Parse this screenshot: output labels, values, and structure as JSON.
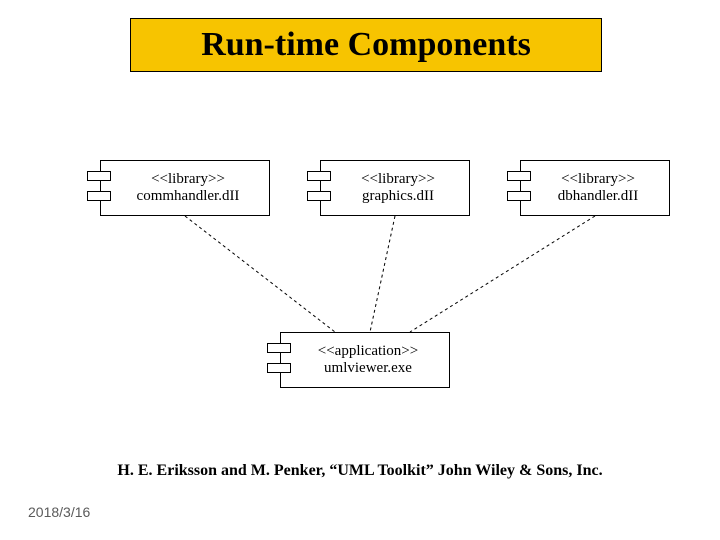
{
  "title": "Run-time Components",
  "components": [
    {
      "stereotype": "<<library>>",
      "name": "commhandler.dII"
    },
    {
      "stereotype": "<<library>>",
      "name": "graphics.dII"
    },
    {
      "stereotype": "<<library>>",
      "name": "dbhandler.dII"
    },
    {
      "stereotype": "<<application>>",
      "name": "umlviewer.exe"
    }
  ],
  "citation": "H. E. Eriksson and M. Penker, “UML Toolkit” John Wiley & Sons, Inc.",
  "date": "2018/3/16",
  "chart_data": {
    "type": "diagram",
    "diagram_kind": "UML component / deployment",
    "title": "Run-time Components",
    "nodes": [
      {
        "id": "commhandler",
        "stereotype": "library",
        "label": "commhandler.dII"
      },
      {
        "id": "graphics",
        "stereotype": "library",
        "label": "graphics.dII"
      },
      {
        "id": "dbhandler",
        "stereotype": "library",
        "label": "dbhandler.dII"
      },
      {
        "id": "umlviewer",
        "stereotype": "application",
        "label": "umlviewer.exe"
      }
    ],
    "edges": [
      {
        "from": "umlviewer",
        "to": "commhandler",
        "style": "dashed",
        "relation": "dependency"
      },
      {
        "from": "umlviewer",
        "to": "graphics",
        "style": "dashed",
        "relation": "dependency"
      },
      {
        "from": "umlviewer",
        "to": "dbhandler",
        "style": "dashed",
        "relation": "dependency"
      }
    ],
    "source_citation": "H. E. Eriksson and M. Penker, “UML Toolkit” John Wiley & Sons, Inc."
  }
}
